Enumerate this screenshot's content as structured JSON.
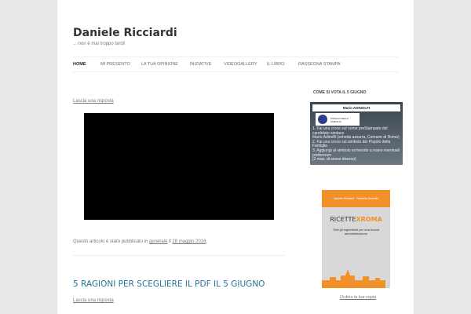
{
  "site": {
    "title": "Daniele Ricciardi",
    "tagline": "... non è mai troppo tardi!"
  },
  "nav": [
    "HOME",
    "MI PRESENTO",
    "LA TUA OPINIONE",
    "INIZIATIVE",
    "VIDEOGALLERY",
    "IL LIBRO",
    "RASSEGNA STAMPA"
  ],
  "post1": {
    "reply": "Lascia una risposta",
    "meta_prefix": "Questo articolo è stato pubblicato in ",
    "category": "generale",
    "meta_mid": " il ",
    "date": "28 maggio 2016",
    "meta_end": "."
  },
  "post2": {
    "title": "5 RAGIONI PER SCEGLIERE IL PDF IL 5 GIUGNO",
    "reply": "Lascia una risposta"
  },
  "sidebar": {
    "heading": "COME SI VOTA IL 5 GIUGNO",
    "vote_image": {
      "name": "Mario ADINOLFI",
      "party": "POPOLO DELLA FAMIGLIA",
      "lines": [
        "1. Fai una croce sul nome preStampato del candidato sindaco",
        "Mario Adinolfi (scheda azzurra, Comune di Roma)",
        "2. Fai una croce sul simbolo del Popolo della Famiglia",
        "3. Aggiungi al simbolo scrivendo a mano eventuali preferenze",
        "(2 max, di sesso diverso)"
      ]
    },
    "book": {
      "authors": "Daniele Ricciardi · Rossella Scarolini",
      "title_a": "RICETTE",
      "title_x": "X",
      "title_b": "ROMA",
      "subtitle": "Tutti gli ingredienti per una buona amministrazione"
    },
    "order_link": "Ordina la tua copia"
  }
}
